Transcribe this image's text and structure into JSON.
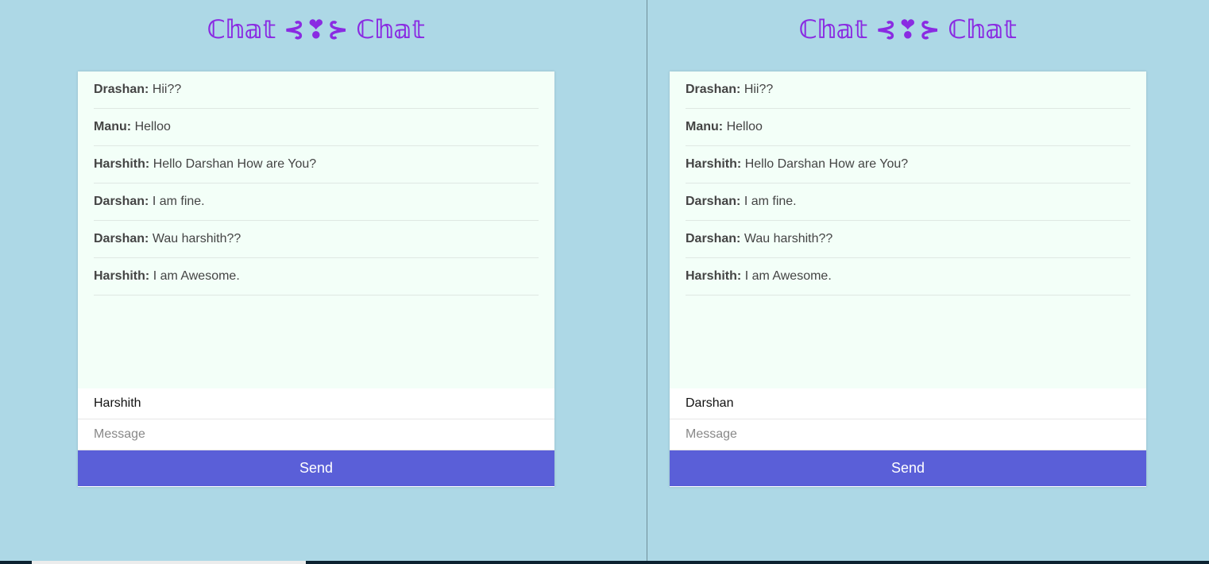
{
  "left_window": {
    "title": "ℂ𝕙𝕒𝕥 ⊰❣⊱ ℂ𝕙𝕒𝕥",
    "messages": [
      {
        "author": "Drashan:",
        "text": "Hii??"
      },
      {
        "author": "Manu:",
        "text": "Helloo"
      },
      {
        "author": "Harshith:",
        "text": "Hello Darshan How are You?"
      },
      {
        "author": "Darshan:",
        "text": "I am fine."
      },
      {
        "author": "Darshan:",
        "text": "Wau harshith??"
      },
      {
        "author": "Harshith:",
        "text": "I am Awesome."
      }
    ],
    "name_value": "Harshith",
    "message_placeholder": "Message",
    "send_label": "Send"
  },
  "right_window": {
    "title": "ℂ𝕙𝕒𝕥 ⊰❣⊱ ℂ𝕙𝕒𝕥",
    "messages": [
      {
        "author": "Drashan:",
        "text": "Hii??"
      },
      {
        "author": "Manu:",
        "text": "Helloo"
      },
      {
        "author": "Harshith:",
        "text": "Hello Darshan How are You?"
      },
      {
        "author": "Darshan:",
        "text": "I am fine."
      },
      {
        "author": "Darshan:",
        "text": "Wau harshith??"
      },
      {
        "author": "Harshith:",
        "text": "I am Awesome."
      }
    ],
    "name_value": "Darshan",
    "message_placeholder": "Message",
    "send_label": "Send"
  },
  "colors": {
    "background": "#add8e6",
    "title": "#8a2be2",
    "send_button": "#5a5fd8",
    "messages_bg": "#f3fff8"
  }
}
